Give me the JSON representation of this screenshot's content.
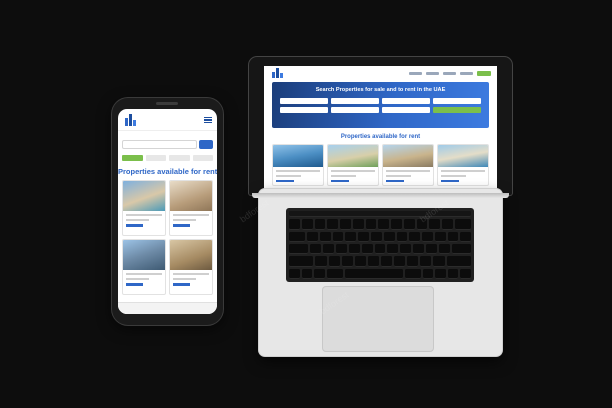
{
  "phone": {
    "section_title": "Properties available for rent"
  },
  "laptop": {
    "hero_title": "Search Properties for sale and to rent in the UAE",
    "section_title": "Properties available for rent"
  },
  "watermark": "bdforest",
  "colors": {
    "brand_blue": "#2f67c7",
    "accent_green": "#7bbf4b",
    "hero_dark": "#1b3d7a"
  }
}
